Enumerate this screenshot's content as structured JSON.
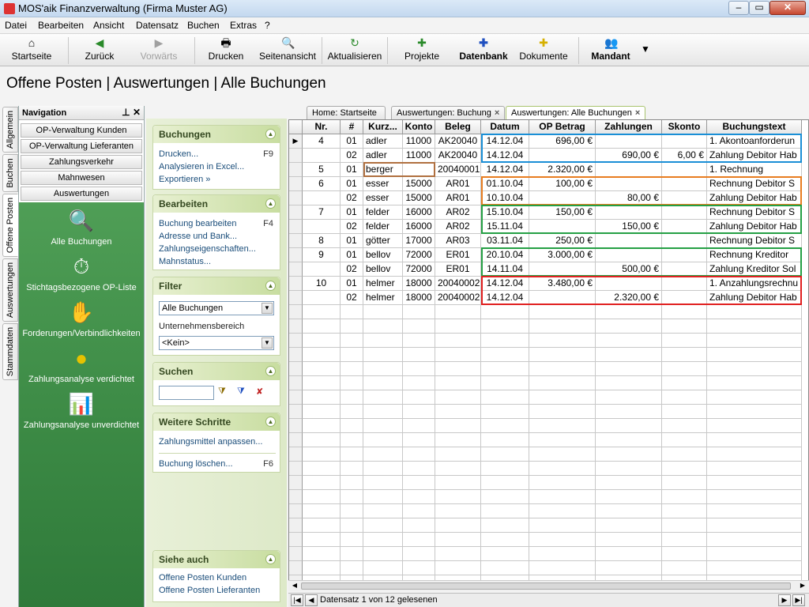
{
  "window": {
    "title": "MOS'aik Finanzverwaltung (Firma Muster AG)"
  },
  "menu": [
    "Datei",
    "Bearbeiten",
    "Ansicht",
    "Datensatz",
    "Buchen",
    "Extras",
    "?"
  ],
  "toolbar": {
    "startseite": "Startseite",
    "zurueck": "Zurück",
    "vorwaerts": "Vorwärts",
    "drucken": "Drucken",
    "seitenansicht": "Seitenansicht",
    "aktualisieren": "Aktualisieren",
    "projekte": "Projekte",
    "datenbank": "Datenbank",
    "dokumente": "Dokumente",
    "mandant": "Mandant"
  },
  "page_title": "Offene Posten | Auswertungen | Alle Buchungen",
  "vtabs": [
    "Allgemein",
    "Buchen",
    "Offene Posten",
    "Auswertungen",
    "Stammdaten"
  ],
  "navigation": {
    "title": "Navigation",
    "buttons": [
      "OP-Verwaltung Kunden",
      "OP-Verwaltung Lieferanten",
      "Zahlungsverkehr",
      "Mahnwesen",
      "Auswertungen"
    ],
    "items": [
      "Alle Buchungen",
      "Stichtagsbezogene OP-Liste",
      "Forderungen/Verbindlichkeiten",
      "Zahlungsanalyse verdichtet",
      "Zahlungsanalyse unverdichtet"
    ]
  },
  "tasks": {
    "buchungen": {
      "title": "Buchungen",
      "drucken": "Drucken...",
      "drucken_key": "F9",
      "excel": "Analysieren in Excel...",
      "export": "Exportieren »"
    },
    "bearbeiten": {
      "title": "Bearbeiten",
      "edit": "Buchung bearbeiten",
      "edit_key": "F4",
      "adresse": "Adresse und Bank...",
      "zahlung": "Zahlungseigenschaften...",
      "mahn": "Mahnstatus..."
    },
    "filter": {
      "title": "Filter",
      "select": "Alle Buchungen",
      "label": "Unternehmensbereich",
      "bereich": "<Kein>"
    },
    "suchen": {
      "title": "Suchen",
      "value": ""
    },
    "weitere": {
      "title": "Weitere Schritte",
      "anpassen": "Zahlungsmittel anpassen...",
      "loeschen": "Buchung löschen...",
      "loeschen_key": "F6"
    },
    "siehe": {
      "title": "Siehe auch",
      "kunden": "Offene Posten Kunden",
      "lieferanten": "Offene Posten Lieferanten"
    }
  },
  "tabs": [
    {
      "label": "Home: Startseite",
      "close": ""
    },
    {
      "label": "Auswertungen: Buchung",
      "close": "×"
    },
    {
      "label": "Auswertungen: Alle Buchungen",
      "close": "×"
    }
  ],
  "grid": {
    "columns": [
      "Nr.",
      "#",
      "Kurz...",
      "Konto",
      "Beleg",
      "Datum",
      "OP Betrag",
      "Zahlungen",
      "Skonto",
      "Buchungstext"
    ],
    "rows": [
      [
        "4",
        "01",
        "adler",
        "11000",
        "AK20040",
        "14.12.04",
        "696,00 €",
        "",
        "",
        "1. Akontoanforderun"
      ],
      [
        "",
        "02",
        "adler",
        "11000",
        "AK20040",
        "14.12.04",
        "",
        "690,00 €",
        "6,00 €",
        "Zahlung Debitor Hab"
      ],
      [
        "5",
        "01",
        "berger",
        "",
        "20040001",
        "14.12.04",
        "2.320,00 €",
        "",
        "",
        "1. Rechnung"
      ],
      [
        "6",
        "01",
        "esser",
        "15000",
        "AR01",
        "01.10.04",
        "100,00 €",
        "",
        "",
        "Rechnung Debitor S"
      ],
      [
        "",
        "02",
        "esser",
        "15000",
        "AR01",
        "10.10.04",
        "",
        "80,00 €",
        "",
        "Zahlung Debitor Hab"
      ],
      [
        "7",
        "01",
        "felder",
        "16000",
        "AR02",
        "15.10.04",
        "150,00 €",
        "",
        "",
        "Rechnung Debitor S"
      ],
      [
        "",
        "02",
        "felder",
        "16000",
        "AR02",
        "15.11.04",
        "",
        "150,00 €",
        "",
        "Zahlung Debitor Hab"
      ],
      [
        "8",
        "01",
        "götter",
        "17000",
        "AR03",
        "03.11.04",
        "250,00 €",
        "",
        "",
        "Rechnung Debitor S"
      ],
      [
        "9",
        "01",
        "bellov",
        "72000",
        "ER01",
        "20.10.04",
        "3.000,00 €",
        "",
        "",
        "Rechnung Kreditor"
      ],
      [
        "",
        "02",
        "bellov",
        "72000",
        "ER01",
        "14.11.04",
        "",
        "500,00 €",
        "",
        "Zahlung Kreditor Sol"
      ],
      [
        "10",
        "01",
        "helmer",
        "18000",
        "20040002",
        "14.12.04",
        "3.480,00 €",
        "",
        "",
        "1. Anzahlungsrechnu"
      ],
      [
        "",
        "02",
        "helmer",
        "18000",
        "20040002",
        "14.12.04",
        "",
        "2.320,00 €",
        "",
        "Zahlung Debitor Hab"
      ]
    ],
    "highlight_colors": {
      "blue": "#1a8fd6",
      "brown": "#b07040",
      "orange": "#e87d20",
      "green": "#25a045",
      "red": "#e02020"
    }
  },
  "record_nav": {
    "status": "Datensatz 1 von 12 gelesenen"
  },
  "colors": {
    "nav_green": "#3c8a45",
    "task_bg": "#e3ecd0",
    "link": "#1a4d7a"
  }
}
